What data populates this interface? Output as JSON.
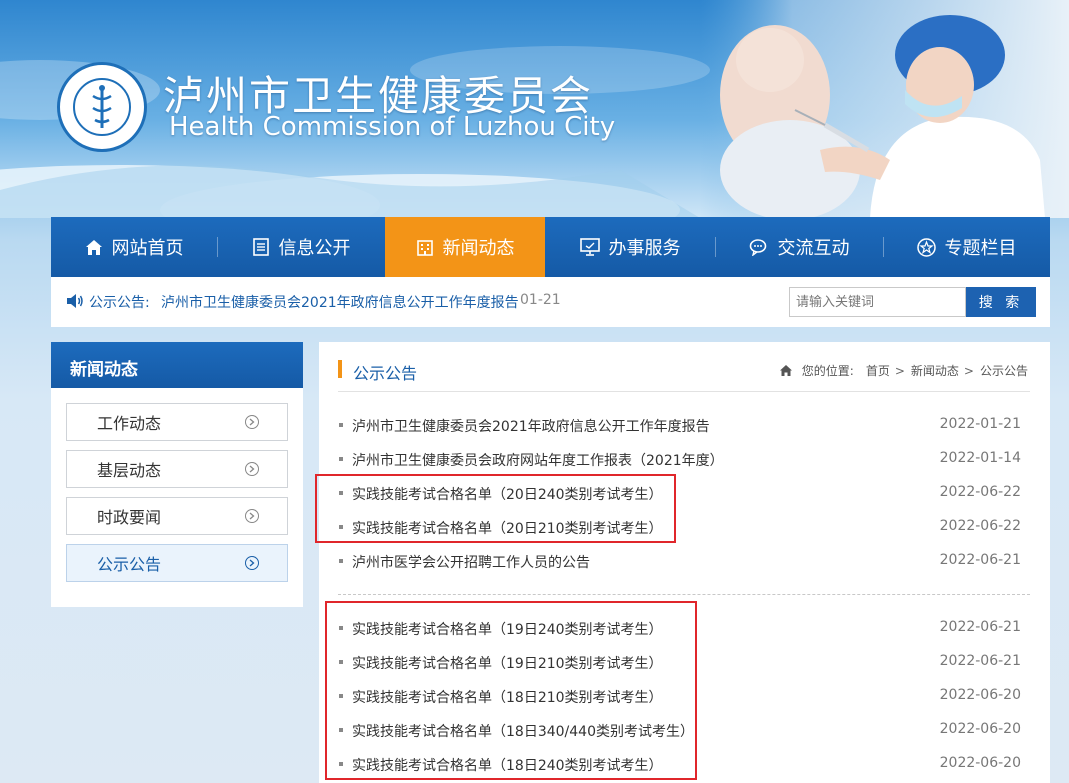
{
  "header": {
    "title_cn": "泸州市卫生健康委员会",
    "title_en": "Health Commission of Luzhou City",
    "logo_icon": "health-commission-seal-icon"
  },
  "nav": {
    "items": [
      {
        "label": "网站首页",
        "icon": "home-icon"
      },
      {
        "label": "信息公开",
        "icon": "document-list-icon"
      },
      {
        "label": "新闻动态",
        "icon": "building-icon",
        "active": true
      },
      {
        "label": "办事服务",
        "icon": "monitor-icon"
      },
      {
        "label": "交流互动",
        "icon": "chat-bubbles-icon"
      },
      {
        "label": "专题栏目",
        "icon": "star-circle-icon"
      }
    ],
    "active_color": "#f39417",
    "bar_color": "#1d6bbd"
  },
  "notice": {
    "label": "公示公告:",
    "text": "泸州市卫生健康委员会2021年政府信息公开工作年度报告",
    "date": "01-21"
  },
  "search": {
    "placeholder": "请输入关键词",
    "value": "",
    "button_label": "搜 索"
  },
  "sidebar": {
    "title": "新闻动态",
    "items": [
      {
        "label": "工作动态"
      },
      {
        "label": "基层动态"
      },
      {
        "label": "时政要闻"
      },
      {
        "label": "公示公告",
        "active": true
      }
    ]
  },
  "content": {
    "section_title": "公示公告",
    "breadcrumb": {
      "prefix": "您的位置:",
      "items": [
        "首页",
        "新闻动态",
        "公示公告"
      ]
    },
    "news": [
      {
        "title": "泸州市卫生健康委员会2021年政府信息公开工作年度报告",
        "date": "2022-01-21"
      },
      {
        "title": "泸州市卫生健康委员会政府网站年度工作报表（2021年度）",
        "date": "2022-01-14"
      },
      {
        "title": "实践技能考试合格名单（20日240类别考试考生）",
        "date": "2022-06-22"
      },
      {
        "title": "实践技能考试合格名单（20日210类别考试考生）",
        "date": "2022-06-22"
      },
      {
        "title": "泸州市医学会公开招聘工作人员的公告",
        "date": "2022-06-21"
      },
      {
        "title": "实践技能考试合格名单（19日240类别考试考生）",
        "date": "2022-06-21"
      },
      {
        "title": "实践技能考试合格名单（19日210类别考试考生）",
        "date": "2022-06-21"
      },
      {
        "title": "实践技能考试合格名单（18日210类别考试考生）",
        "date": "2022-06-20"
      },
      {
        "title": "实践技能考试合格名单（18日340/440类别考试考生）",
        "date": "2022-06-20"
      },
      {
        "title": "实践技能考试合格名单（18日240类别考试考生）",
        "date": "2022-06-20"
      }
    ],
    "highlight_color": "#e0262b"
  }
}
